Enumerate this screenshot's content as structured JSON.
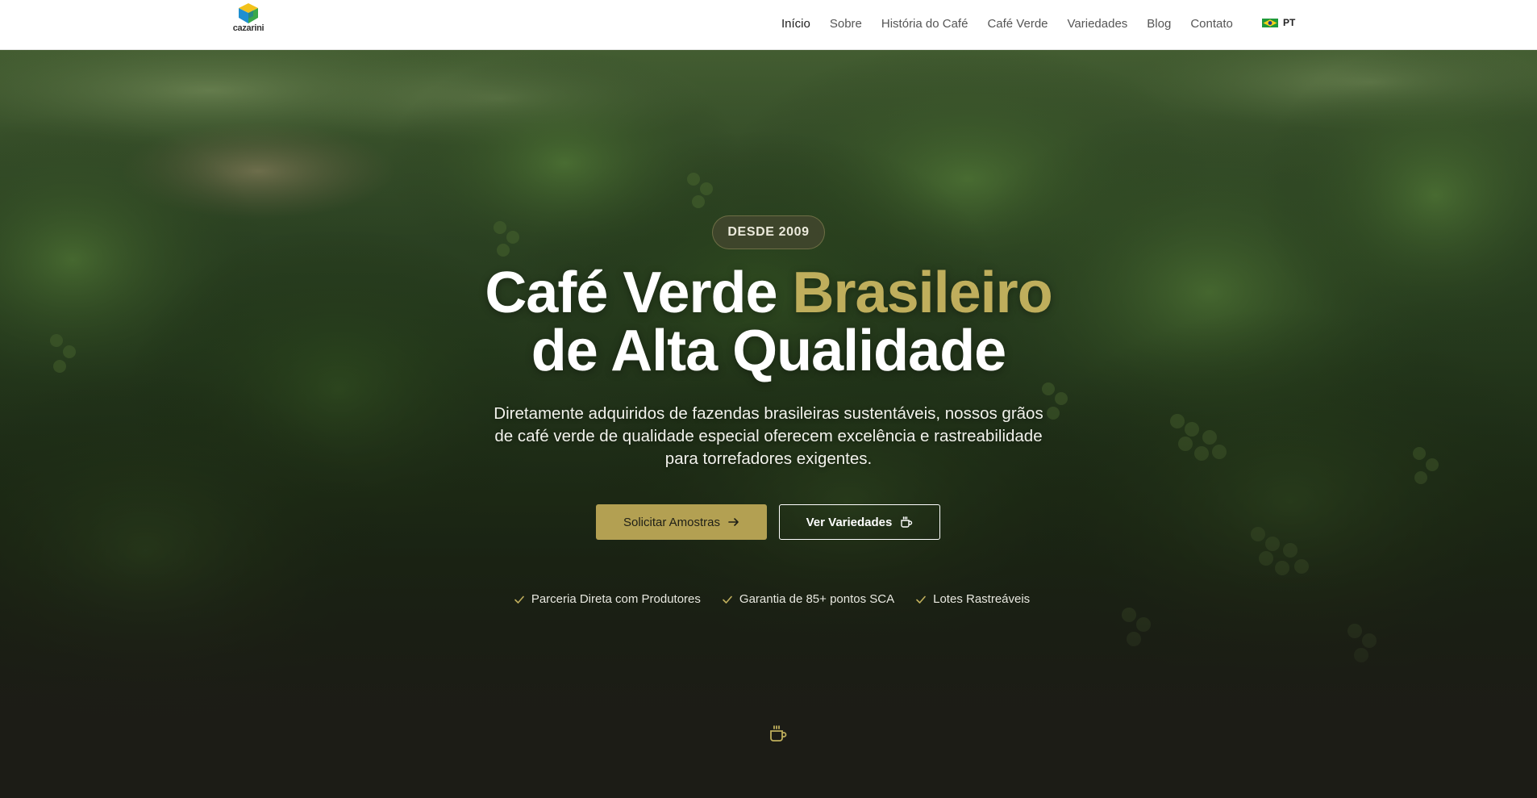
{
  "brand": {
    "name": "cazarini",
    "logo_icon": "cube-logo-icon"
  },
  "nav": {
    "items": [
      {
        "label": "Início",
        "active": true
      },
      {
        "label": "Sobre"
      },
      {
        "label": "História do Café"
      },
      {
        "label": "Café Verde"
      },
      {
        "label": "Variedades"
      },
      {
        "label": "Blog"
      },
      {
        "label": "Contato"
      }
    ],
    "language": {
      "label": "PT",
      "flag_icon": "brazil-flag-icon"
    }
  },
  "hero": {
    "badge": "DESDE 2009",
    "headline_part1": "Café Verde ",
    "headline_accent": "Brasileiro",
    "headline_line2": "de Alta Qualidade",
    "subtitle": "Diretamente adquiridos de fazendas brasileiras sustentáveis, nossos grãos de café verde de qualidade especial oferecem excelência e rastreabilidade para torrefadores exigentes.",
    "primary_button": {
      "label": "Solicitar Amostras",
      "icon": "arrow-right-icon"
    },
    "secondary_button": {
      "label": "Ver Variedades",
      "icon": "coffee-cup-icon"
    },
    "features": [
      {
        "label": "Parceria Direta com Produtores",
        "icon": "check-icon"
      },
      {
        "label": "Garantia de 85+ pontos SCA",
        "icon": "check-icon"
      },
      {
        "label": "Lotes Rastreáveis",
        "icon": "check-icon"
      }
    ],
    "scroll_icon": "coffee-cup-icon"
  },
  "colors": {
    "accent": "#bfae5c",
    "button_primary": "#b3a052",
    "dark_background": "#1c1c16",
    "nav_background": "#ffffff"
  }
}
